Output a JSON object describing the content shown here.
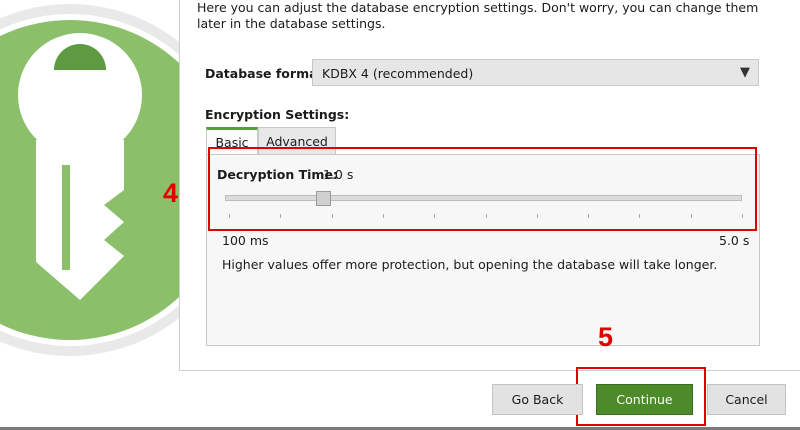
{
  "intro_text": "Here you can adjust the database encryption settings. Don't worry, you can change them later in the database settings.",
  "database_format": {
    "label": "Database format:",
    "selected": "KDBX 4 (recommended)"
  },
  "encryption_settings": {
    "label": "Encryption Settings:",
    "tabs": [
      {
        "label": "Basic",
        "active": true
      },
      {
        "label": "Advanced",
        "active": false
      }
    ],
    "decryption_time": {
      "label": "Decryption Time:",
      "value": "1.0 s",
      "slider_fraction": 0.19,
      "min_label": "100 ms",
      "max_label": "5.0 s"
    },
    "help_text": "Higher values offer more protection, but opening the database will take longer."
  },
  "annotations": {
    "step_4": "4",
    "step_5": "5",
    "color": "#e00000"
  },
  "buttons": {
    "back": "Go Back",
    "continue": "Continue",
    "cancel": "Cancel"
  },
  "colors": {
    "accent_green": "#4c8a2a",
    "tab_indicator": "#5a9a3a"
  },
  "icons": {
    "logo": "keepassxc-key-logo",
    "dropdown": "triangle-down-icon"
  }
}
